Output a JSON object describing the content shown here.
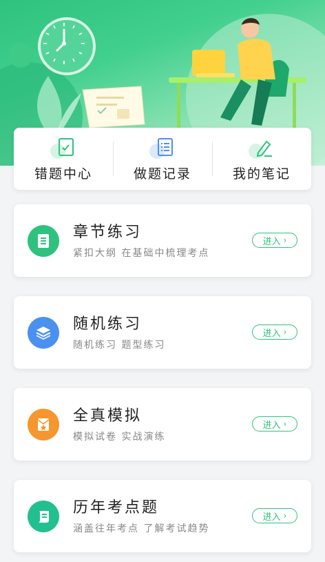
{
  "nav": {
    "items": [
      {
        "label": "错题中心",
        "icon": "wrong-questions-icon"
      },
      {
        "label": "做题记录",
        "icon": "records-list-icon"
      },
      {
        "label": "我的笔记",
        "icon": "notes-pen-icon"
      }
    ]
  },
  "practice": {
    "enter_label": "进入",
    "items": [
      {
        "title": "章节练习",
        "subtitle": "紧扣大纲 在基础中梳理考点",
        "icon": "chapter-doc-icon",
        "color": "#2ec27e"
      },
      {
        "title": "随机练习",
        "subtitle": "随机练习 题型练习",
        "icon": "layers-icon",
        "color": "#4a90ef"
      },
      {
        "title": "全真模拟",
        "subtitle": "模拟试卷 实战演练",
        "icon": "envelope-star-icon",
        "color": "#f5962e"
      },
      {
        "title": "历年考点题",
        "subtitle": "涵盖往年考点 了解考试趋势",
        "icon": "scroll-icon",
        "color": "#22c08f"
      }
    ]
  },
  "colors": {
    "accent": "#2ec27e",
    "background": "#f3f4f6"
  }
}
